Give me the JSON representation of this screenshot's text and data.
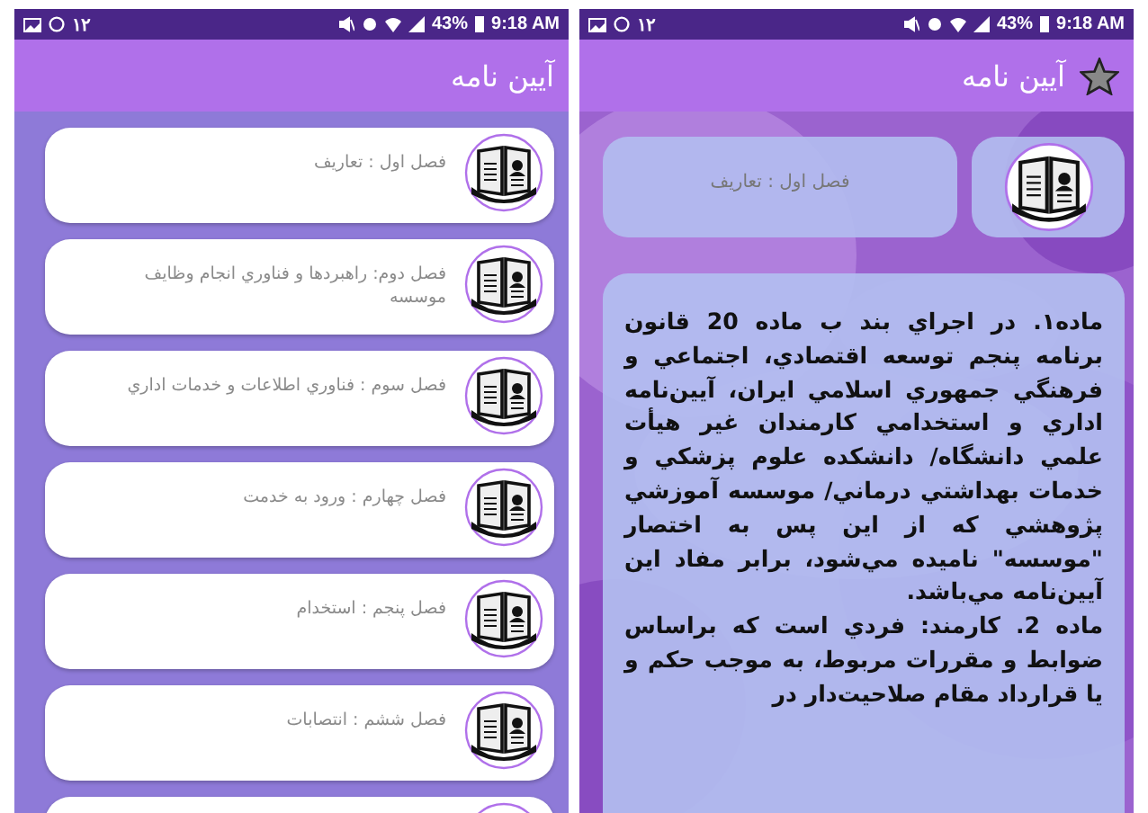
{
  "list_screen": {
    "status_bar": {
      "notification_count": "۱۲",
      "battery": "43%",
      "time": "9:18 AM"
    },
    "app_bar": {
      "title": "آیین نامه"
    },
    "chapters": [
      {
        "kind": "chapter",
        "title": "فصل اول : تعاریف"
      },
      {
        "kind": "chapter",
        "title": "فصل دوم: راهبردها و فناوري انجام وظايف موسسه"
      },
      {
        "kind": "chapter",
        "title": "فصل سوم : فناوري اطلاعات و خدمات اداري"
      },
      {
        "kind": "chapter",
        "title": "فصل چهارم :  ورود به خدمت"
      },
      {
        "kind": "chapter",
        "title": "فصل پنجم : استخدام"
      },
      {
        "kind": "chapter",
        "title": "فصل ششم : انتصابات"
      },
      {
        "kind": "cut"
      }
    ]
  },
  "detail_screen": {
    "status_bar": {
      "notification_count": "۱۲",
      "battery": "43%",
      "time": "9:18 AM"
    },
    "app_bar": {
      "title": "آیین نامه",
      "favorite": false
    },
    "chapter_title": "فصل اول : تعاریف",
    "paragraphs": [
      "ماده۱.  در اجراي بند ب ماده 20 قانون برنامه پنجم توسعه اقتصادي، اجتماعي و فرهنگي جمهوري اسلامي ايران، آيين‌نامه اداري و استخدامي كارمندان غير هيأت علمي دانشگاه/ دانشكده علوم پزشكي و خدمات بهداشتي درماني/ موسسه آموزشي پژوهشي كه از اين پس به اختصار \"موسسه\" ناميده مي‌شود، برابر مفاد اين آيين‌نامه مي‌باشد.",
      "ماده 2. كارمند: فردي است كه براساس ضوابط و مقررات مربوط، به موجب حكم و يا قرارداد مقام صلاحيت‌دار در"
    ]
  }
}
